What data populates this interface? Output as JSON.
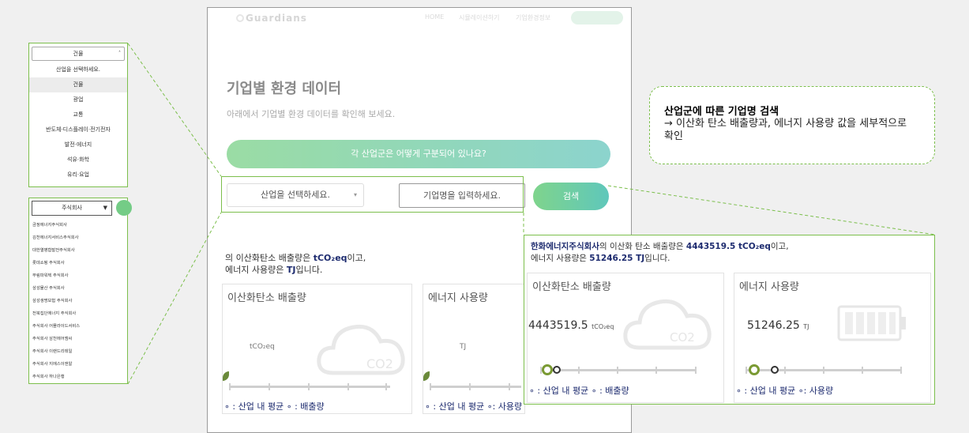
{
  "nav": {
    "logo": "Guardians",
    "links": [
      "HOME",
      "시뮬레이션하기",
      "기업환경정보"
    ]
  },
  "main": {
    "title": "기업별 환경 데이터",
    "subtitle": "아래에서 기업별 환경 데이터를 확인해 보세요.",
    "cta": "각 산업군은 어떻게 구분되어 있나요?",
    "industry_placeholder": "산업을 선택하세요.",
    "company_placeholder": "기업명을 입력하세요.",
    "search_label": "검색",
    "result_line1_pre": "의 이산화탄소 배출량은 ",
    "result_co2_unit": "tCO₂eq",
    "result_line1_post": "이고,",
    "result_line2_pre": "에너지 사용량은 ",
    "result_energy_unit": "TJ",
    "result_line2_post": "입니다.",
    "card_co2_title": "이산화탄소 배출량",
    "card_co2_unit": "tCO₂eq",
    "card_energy_title": "에너지 사용량",
    "card_energy_unit": "TJ",
    "co2_icon_label": "CO2",
    "legend_avg": "∘ : 산업 내 평균",
    "legend_emission": "∘ : 배출량",
    "legend_usage": "∘: 사용량"
  },
  "industry_panel": {
    "selected": "건물",
    "options": [
      "산업을 선택하세요.",
      "건물",
      "광업",
      "교통",
      "반도체·디스플레이·전기전자",
      "발전·에너지",
      "석유·화학",
      "유리·요업"
    ]
  },
  "company_panel": {
    "selected": "주식회사",
    "companies": [
      "금정에너지주식회사",
      "김천에너지서비스주식회사",
      "대한열병합발전주식회사",
      "롯데쇼핑 주식회사",
      "무림파워텍 주식회사",
      "삼성물산 주식회사",
      "삼성생명보험 주식회사",
      "전북집단에너지 주식회사",
      "주식회사 어플라이드서비스",
      "주식회사 삼천에어엠씨",
      "주식회사 이랜드리테일",
      "주식회사 지에스이앤알",
      "주식회사 하나은행"
    ]
  },
  "annotation": {
    "title": "산업군에 따른 기업명 검색",
    "body": "→ 이산화 탄소 배출량과, 에너지 사용량 값을 세부적으로 확인"
  },
  "zoom": {
    "company": "한화에너지주식회사",
    "line1_mid": "의 이산화 탄소 배출량은 ",
    "co2_value_text": "4443519.5 tCO₂eq",
    "line1_post": "이고,",
    "line2_pre": "에너지 사용량은 ",
    "energy_value_text": "51246.25 TJ",
    "line2_post": "입니다.",
    "card_co2_title": "이산화탄소 배출량",
    "card_energy_title": "에너지 사용량",
    "co2_value": "4443519.5",
    "co2_unit": "tCO₂eq",
    "energy_value": "51246.25",
    "energy_unit": "TJ",
    "co2_icon_label": "CO2",
    "legend_avg": "∘ : 산업 내 평균",
    "legend_emission": "∘ : 배출량",
    "legend_avg2": "∘ : 산업 내 평균",
    "legend_usage": "∘: 사용량"
  },
  "colors": {
    "accent_green": "#7cbf4c",
    "navy": "#1d2b6f",
    "button_gradient_start": "#7fd48c",
    "button_gradient_end": "#5fc7bb"
  }
}
